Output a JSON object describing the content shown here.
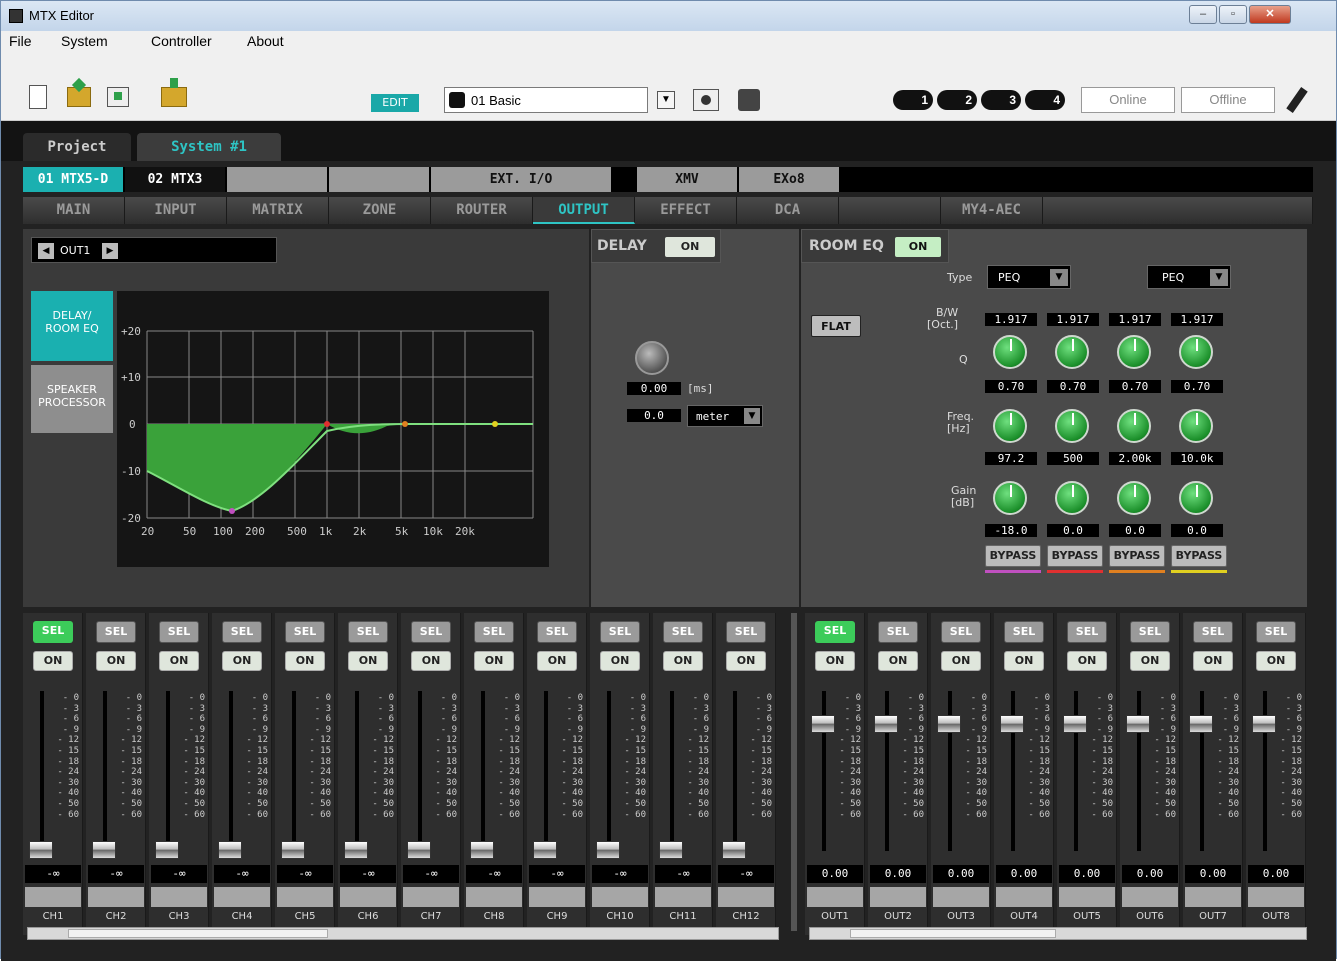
{
  "window": {
    "title": "MTX Editor"
  },
  "menu": [
    "File",
    "System",
    "Controller",
    "About"
  ],
  "toolbar": {
    "mode": "EDIT",
    "preset": "01 Basic",
    "online": "Online",
    "offline": "Offline",
    "leds": [
      "1",
      "2",
      "3",
      "4"
    ]
  },
  "project_tabs": [
    "Project",
    "System #1"
  ],
  "devices": [
    "01 MTX5-D",
    "02 MTX3",
    "",
    "",
    "EXT. I/O",
    "XMV",
    "EXo8"
  ],
  "subtabs": [
    "MAIN",
    "INPUT",
    "MATRIX",
    "ZONE",
    "ROUTER",
    "OUTPUT",
    "EFFECT",
    "DCA",
    "",
    "MY4-AEC"
  ],
  "output_selector": "OUT1",
  "side_buttons": [
    "DELAY/\nROOM EQ",
    "SPEAKER\nPROCESSOR"
  ],
  "graph": {
    "ylabels": [
      "+20",
      "+10",
      "0",
      "-10",
      "-20"
    ],
    "xlabels": [
      "20",
      "50",
      "100",
      "200",
      "500",
      "1k",
      "2k",
      "5k",
      "10k",
      "20k"
    ]
  },
  "delay": {
    "label": "DELAY",
    "on": "ON",
    "ms": "0.00",
    "ms_unit": "[ms]",
    "meter": "0.0",
    "unit": "meter"
  },
  "room_eq": {
    "label": "ROOM EQ",
    "on": "ON",
    "flat": "FLAT",
    "type_label": "Type",
    "types": [
      "PEQ",
      "PEQ"
    ],
    "bw_label": "B/W\n[Oct.]",
    "q_label": "Q",
    "freq_label": "Freq.\n[Hz]",
    "gain_label": "Gain\n[dB]",
    "bw": [
      "1.917",
      "1.917",
      "1.917",
      "1.917"
    ],
    "q": [
      "0.70",
      "0.70",
      "0.70",
      "0.70"
    ],
    "freq": [
      "97.2",
      "500",
      "2.00k",
      "10.0k"
    ],
    "gain": [
      "-18.0",
      "0.0",
      "0.0",
      "0.0"
    ],
    "bypass": "BYPASS",
    "band_colors": [
      "#c050c0",
      "#e03030",
      "#e08020",
      "#e0d020"
    ]
  },
  "strip": {
    "sel": "SEL",
    "on": "ON",
    "scale": [
      "0",
      "3",
      "6",
      "9",
      "12",
      "15",
      "18",
      "24",
      "30",
      "40",
      "50",
      "60"
    ]
  },
  "inputs": [
    "CH1",
    "CH2",
    "CH3",
    "CH4",
    "CH5",
    "CH6",
    "CH7",
    "CH8",
    "CH9",
    "CH10",
    "CH11",
    "CH12"
  ],
  "input_level": "-∞",
  "outputs": [
    "OUT1",
    "OUT2",
    "OUT3",
    "OUT4",
    "OUT5",
    "OUT6",
    "OUT7",
    "OUT8"
  ],
  "output_level": "0.00"
}
